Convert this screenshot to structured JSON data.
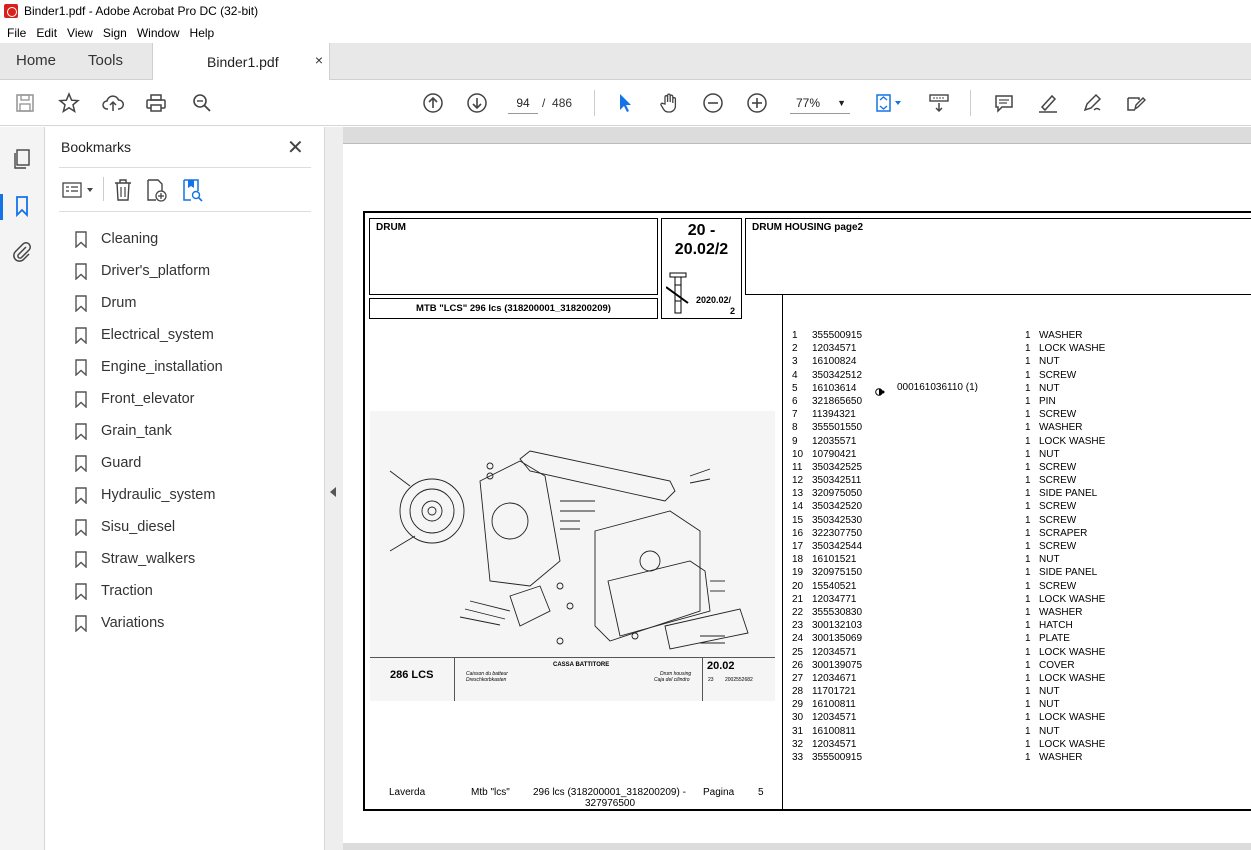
{
  "window": {
    "title": "Binder1.pdf - Adobe Acrobat Pro DC (32-bit)"
  },
  "menu": [
    "File",
    "Edit",
    "View",
    "Sign",
    "Window",
    "Help"
  ],
  "tabs": {
    "home": "Home",
    "tools": "Tools",
    "document": "Binder1.pdf",
    "close": "×"
  },
  "toolbar": {
    "page_current": "94",
    "page_separator": "/",
    "page_total": "486",
    "zoom": "77%"
  },
  "bookmarks": {
    "title": "Bookmarks",
    "close": "✕",
    "items": [
      "Cleaning",
      "Driver's_platform",
      "Drum",
      "Electrical_system",
      "Engine_installation",
      "Front_elevator",
      "Grain_tank",
      "Guard",
      "Hydraulic_system",
      "Sisu_diesel",
      "Straw_walkers",
      "Traction",
      "Variations"
    ]
  },
  "sheet": {
    "group": "DRUM",
    "code_line1": "20 -",
    "code_line2": "20.02/2",
    "code_small_line1": "2020.02/",
    "code_small_line2": "2",
    "model": "MTB \"LCS\" 296 lcs (318200001_318200209)",
    "section_title": "DRUM HOUSING  page2",
    "drawing": {
      "model_label": "286 LCS",
      "title_it": "CASSA BATTITORE",
      "title_fr": "Caisson du batteur",
      "title_de": "Dreschkorbkasten",
      "title_en": "Drum housing",
      "title_es": "Caja del cilindro",
      "group_code": "20.02",
      "sub_code": "23",
      "ref_code": "2002552682"
    },
    "footer": {
      "brand": "Laverda",
      "series": "Mtb \"lcs\"",
      "model_line1": "296 lcs (318200001_318200209) -",
      "model_line2": "327976500",
      "page_label": "Pagina",
      "page_no": "5"
    },
    "note_ref": "000161036110 (1)",
    "parts": [
      [
        "1",
        "355500915",
        "1",
        "WASHER"
      ],
      [
        "2",
        "12034571",
        "1",
        "LOCK WASHE"
      ],
      [
        "3",
        "16100824",
        "1",
        "NUT"
      ],
      [
        "4",
        "350342512",
        "1",
        "SCREW"
      ],
      [
        "5",
        "16103614",
        "1",
        "NUT"
      ],
      [
        "6",
        "321865650",
        "1",
        "PIN"
      ],
      [
        "7",
        "11394321",
        "1",
        "SCREW"
      ],
      [
        "8",
        "355501550",
        "1",
        "WASHER"
      ],
      [
        "9",
        "12035571",
        "1",
        "LOCK WASHE"
      ],
      [
        "10",
        "10790421",
        "1",
        "NUT"
      ],
      [
        "11",
        "350342525",
        "1",
        "SCREW"
      ],
      [
        "12",
        "350342511",
        "1",
        "SCREW"
      ],
      [
        "13",
        "320975050",
        "1",
        "SIDE PANEL"
      ],
      [
        "14",
        "350342520",
        "1",
        "SCREW"
      ],
      [
        "15",
        "350342530",
        "1",
        "SCREW"
      ],
      [
        "16",
        "322307750",
        "1",
        "SCRAPER"
      ],
      [
        "17",
        "350342544",
        "1",
        "SCREW"
      ],
      [
        "18",
        "16101521",
        "1",
        "NUT"
      ],
      [
        "19",
        "320975150",
        "1",
        "SIDE PANEL"
      ],
      [
        "20",
        "15540521",
        "1",
        "SCREW"
      ],
      [
        "21",
        "12034771",
        "1",
        "LOCK WASHE"
      ],
      [
        "22",
        "355530830",
        "1",
        "WASHER"
      ],
      [
        "23",
        "300132103",
        "1",
        "HATCH"
      ],
      [
        "24",
        "300135069",
        "1",
        "PLATE"
      ],
      [
        "25",
        "12034571",
        "1",
        "LOCK WASHE"
      ],
      [
        "26",
        "300139075",
        "1",
        "COVER"
      ],
      [
        "27",
        "12034671",
        "1",
        "LOCK WASHE"
      ],
      [
        "28",
        "11701721",
        "1",
        "NUT"
      ],
      [
        "29",
        "16100811",
        "1",
        "NUT"
      ],
      [
        "30",
        "12034571",
        "1",
        "LOCK WASHE"
      ],
      [
        "31",
        "16100811",
        "1",
        "NUT"
      ],
      [
        "32",
        "12034571",
        "1",
        "LOCK WASHE"
      ],
      [
        "33",
        "355500915",
        "1",
        "WASHER"
      ]
    ]
  }
}
